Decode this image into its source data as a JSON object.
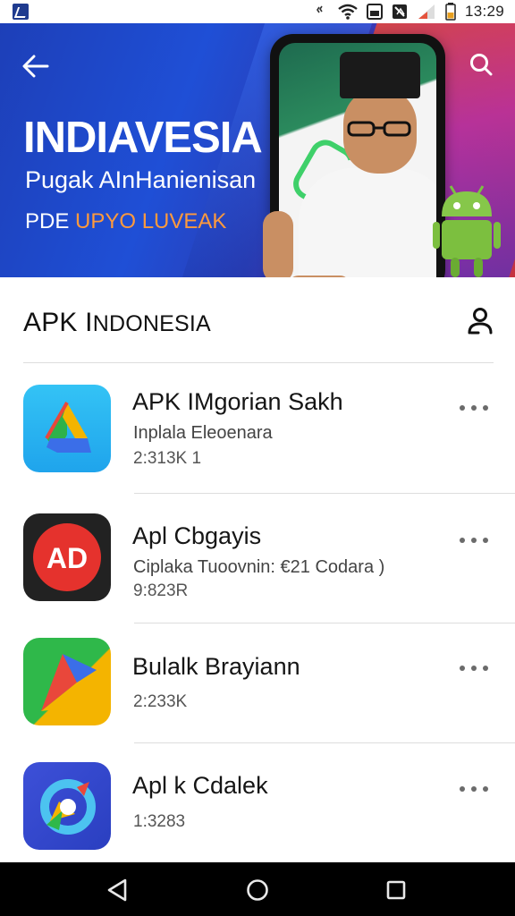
{
  "status_bar": {
    "time": "13:29"
  },
  "banner": {
    "title": "INDIAVESIA",
    "subtitle": "Pugak AInHanienisan",
    "line3_prefix": "PDE ",
    "line3_highlight": "UPYO LUVEAK",
    "accent_color": "#ff9a3c"
  },
  "section": {
    "title_prefix": "APK I",
    "title_rest": "NDONESIA"
  },
  "apps": [
    {
      "name": "APK IMgorian Sakh",
      "desc": "Inplala Eleoenara",
      "size": "2:313K  1",
      "icon": "drive-triangle-icon"
    },
    {
      "name": "Apl Cbgayis",
      "desc": "Ciplaka Tuoovnin: €21 Codara )",
      "size": "9:823R",
      "icon": "ad-badge-icon"
    },
    {
      "name": "Bulalk Brayiann",
      "desc": "",
      "size": "2:233K",
      "icon": "color-arrow-icon"
    },
    {
      "name": "Apl k Cdalek",
      "desc": "",
      "size": "1:3283",
      "icon": "blue-ring-icon"
    }
  ]
}
